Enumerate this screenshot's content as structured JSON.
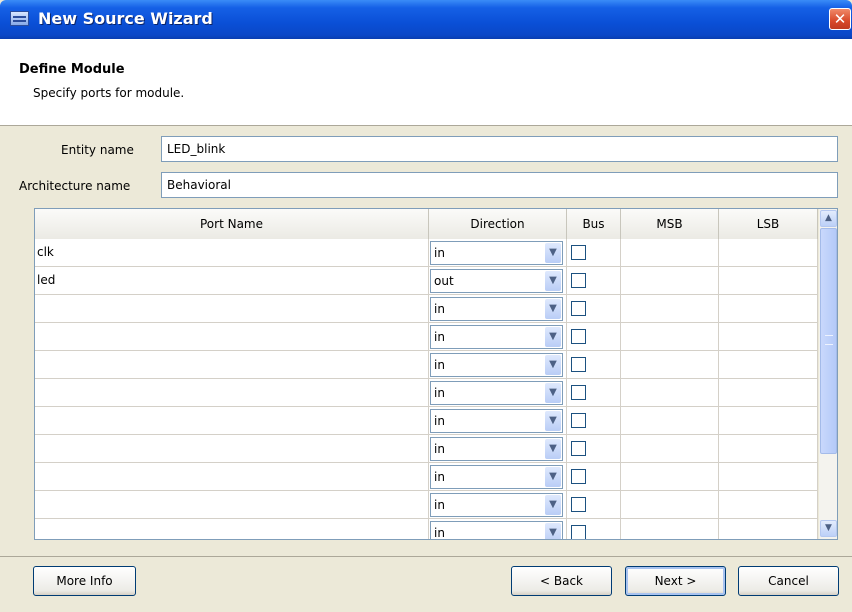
{
  "window": {
    "title": "New Source Wizard",
    "close_glyph": "✕",
    "accent_color": "#0a4fd6"
  },
  "header": {
    "title": "Define Module",
    "subtitle": "Specify ports for module."
  },
  "fields": {
    "entity_label": "Entity name",
    "entity_value": "LED_blink",
    "architecture_label": "Architecture name",
    "architecture_value": "Behavioral"
  },
  "grid": {
    "columns": [
      "Port Name",
      "Direction",
      "Bus",
      "MSB",
      "LSB"
    ],
    "rows": [
      {
        "name": "clk",
        "direction": "in",
        "bus": false,
        "msb": "",
        "lsb": ""
      },
      {
        "name": "led",
        "direction": "out",
        "bus": false,
        "msb": "",
        "lsb": ""
      },
      {
        "name": "",
        "direction": "in",
        "bus": false,
        "msb": "",
        "lsb": ""
      },
      {
        "name": "",
        "direction": "in",
        "bus": false,
        "msb": "",
        "lsb": ""
      },
      {
        "name": "",
        "direction": "in",
        "bus": false,
        "msb": "",
        "lsb": ""
      },
      {
        "name": "",
        "direction": "in",
        "bus": false,
        "msb": "",
        "lsb": ""
      },
      {
        "name": "",
        "direction": "in",
        "bus": false,
        "msb": "",
        "lsb": ""
      },
      {
        "name": "",
        "direction": "in",
        "bus": false,
        "msb": "",
        "lsb": ""
      },
      {
        "name": "",
        "direction": "in",
        "bus": false,
        "msb": "",
        "lsb": ""
      },
      {
        "name": "",
        "direction": "in",
        "bus": false,
        "msb": "",
        "lsb": ""
      },
      {
        "name": "",
        "direction": "in",
        "bus": false,
        "msb": "",
        "lsb": ""
      }
    ]
  },
  "buttons": {
    "more_info": "More Info",
    "back": "< Back",
    "next": "Next >",
    "cancel": "Cancel"
  }
}
